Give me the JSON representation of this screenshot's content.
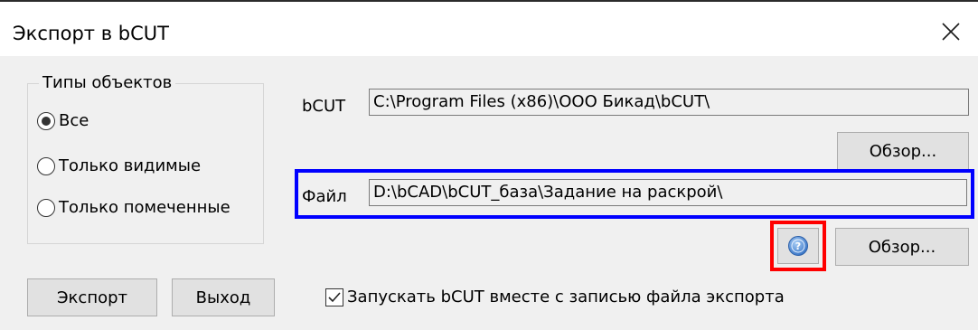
{
  "window": {
    "title": "Экспорт в  bCUT"
  },
  "object_types": {
    "legend": "Типы объектов",
    "options": [
      {
        "label": "Все",
        "selected": true
      },
      {
        "label": "Только видимые",
        "selected": false
      },
      {
        "label": "Только помеченные",
        "selected": false
      }
    ]
  },
  "bcut": {
    "label": "bCUT",
    "path": "C:\\Program Files (x86)\\ООО Бикад\\bCUT\\",
    "browse_label": "Обзор..."
  },
  "file": {
    "label": "Файл",
    "path": "D:\\bCAD\\bCUT_база\\Задание на раскрой\\",
    "browse_label": "Обзор..."
  },
  "buttons": {
    "export_label": "Экспорт",
    "exit_label": "Выход"
  },
  "launch_checkbox": {
    "label": "Запускать bCUT вместе с записью файла экспорта",
    "checked": true
  },
  "icons": {
    "close": "close-icon",
    "help": "help-icon"
  },
  "colors": {
    "dialog_background": "#f0f0f0",
    "button_face": "#e1e1e1",
    "highlight_blue": "#0000ff",
    "highlight_red": "#ff0000",
    "help_icon": "#4a86d4"
  }
}
